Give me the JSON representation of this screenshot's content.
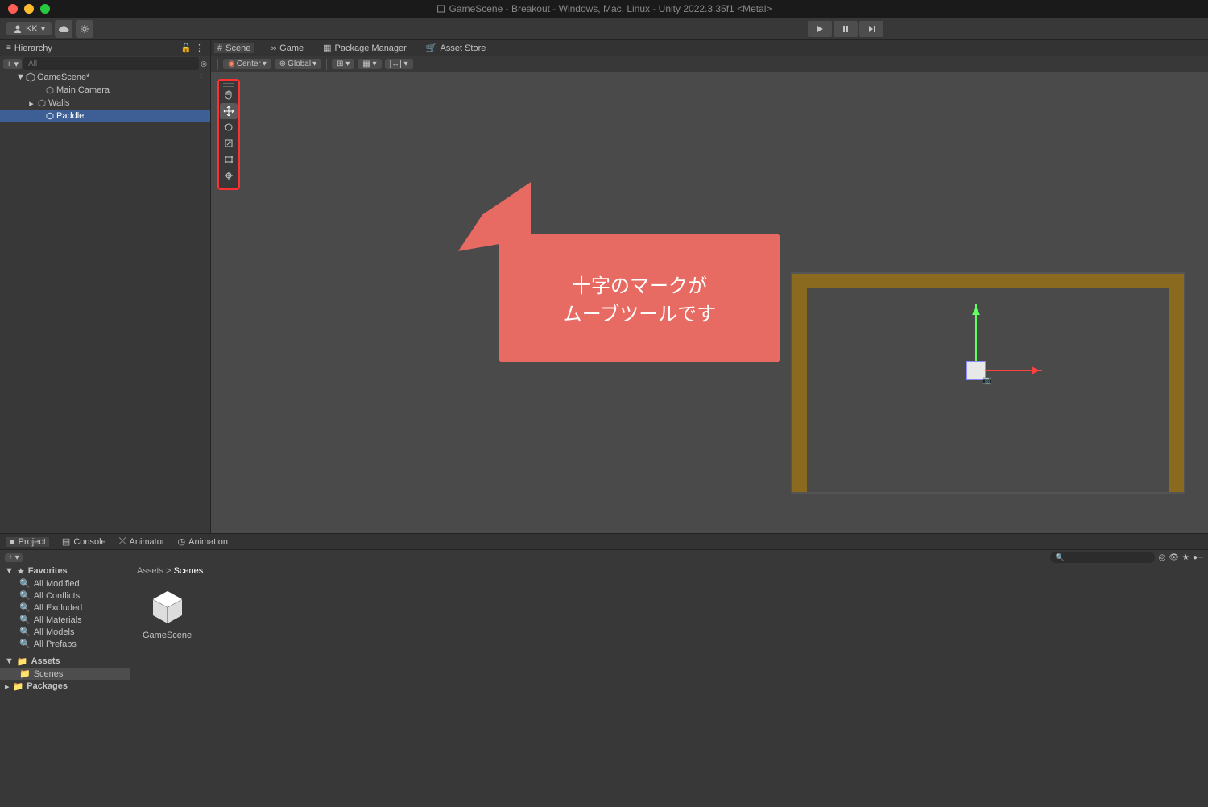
{
  "title": "GameScene - Breakout - Windows, Mac, Linux - Unity 2022.3.35f1 <Metal>",
  "user": "KK",
  "hierarchy": {
    "label": "Hierarchy",
    "search_placeholder": "All",
    "root": "GameScene*",
    "items": [
      "Main Camera",
      "Walls",
      "Paddle"
    ]
  },
  "tabs": {
    "scene": "Scene",
    "game": "Game",
    "pkg": "Package Manager",
    "store": "Asset Store"
  },
  "scene_toolbar": {
    "pivot": "Center",
    "space": "Global"
  },
  "callout": {
    "line1": "十字のマークが",
    "line2": "ムーブツールです"
  },
  "bottom_tabs": {
    "project": "Project",
    "console": "Console",
    "animator": "Animator",
    "animation": "Animation"
  },
  "project": {
    "favorites": "Favorites",
    "fav_items": [
      "All Modified",
      "All Conflicts",
      "All Excluded",
      "All Materials",
      "All Models",
      "All Prefabs"
    ],
    "assets": "Assets",
    "scenes_folder": "Scenes",
    "packages": "Packages",
    "crumb_root": "Assets",
    "crumb_cur": "Scenes",
    "asset_name": "GameScene"
  }
}
